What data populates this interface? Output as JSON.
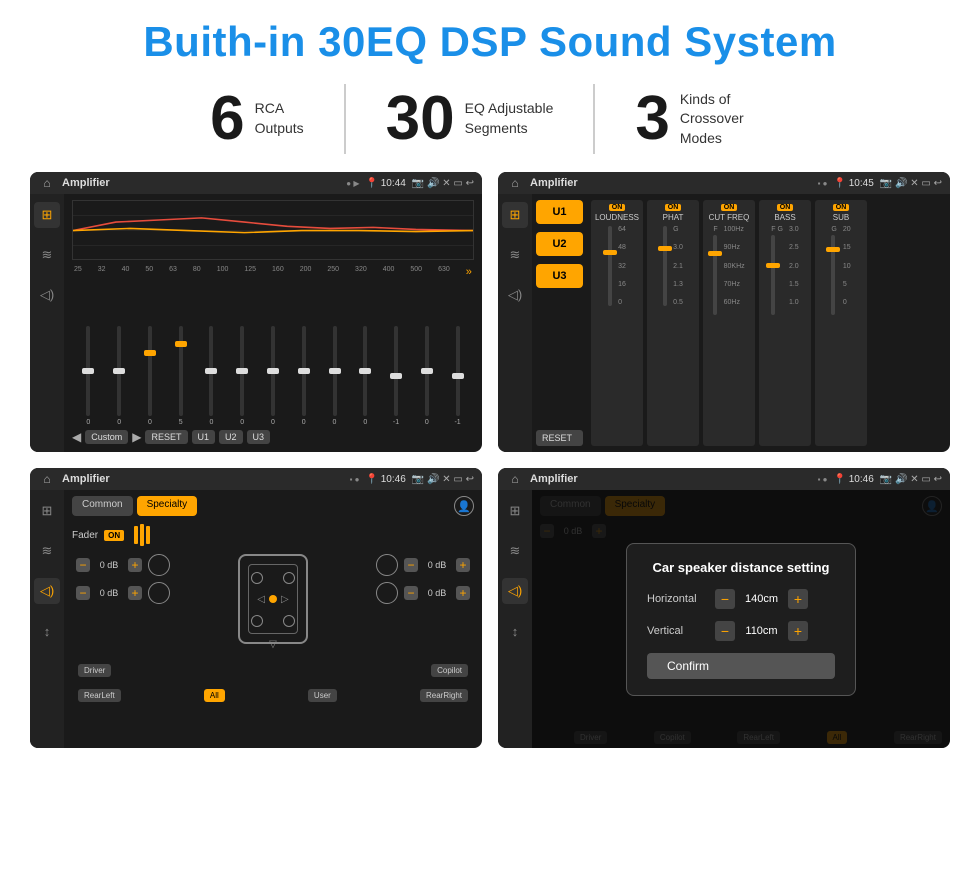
{
  "header": {
    "title": "Buith-in 30EQ DSP Sound System"
  },
  "stats": [
    {
      "number": "6",
      "desc": "RCA\nOutputs"
    },
    {
      "number": "30",
      "desc": "EQ Adjustable\nSegments"
    },
    {
      "number": "3",
      "desc": "Kinds of\nCrossover Modes"
    }
  ],
  "screens": [
    {
      "id": "screen1",
      "topbar": {
        "title": "Amplifier",
        "time": "10:44"
      },
      "type": "eq"
    },
    {
      "id": "screen2",
      "topbar": {
        "title": "Amplifier",
        "time": "10:45"
      },
      "type": "crossover"
    },
    {
      "id": "screen3",
      "topbar": {
        "title": "Amplifier",
        "time": "10:46"
      },
      "type": "fader"
    },
    {
      "id": "screen4",
      "topbar": {
        "title": "Amplifier",
        "time": "10:46"
      },
      "type": "distance"
    }
  ],
  "eq": {
    "frequencies": [
      "25",
      "32",
      "40",
      "50",
      "63",
      "80",
      "100",
      "125",
      "160",
      "200",
      "250",
      "320",
      "400",
      "500",
      "630"
    ],
    "values": [
      "0",
      "0",
      "0",
      "5",
      "0",
      "0",
      "0",
      "0",
      "0",
      "0",
      "-1",
      "0",
      "-1"
    ],
    "preset": "Custom",
    "buttons": [
      "RESET",
      "U1",
      "U2",
      "U3"
    ]
  },
  "crossover": {
    "units": [
      "U1",
      "U2",
      "U3"
    ],
    "cols": [
      {
        "label": "LOUDNESS",
        "on": true
      },
      {
        "label": "PHAT",
        "on": true
      },
      {
        "label": "CUT FREQ",
        "on": true
      },
      {
        "label": "BASS",
        "on": true
      },
      {
        "label": "SUB",
        "on": true
      }
    ]
  },
  "fader": {
    "tabs": [
      "Common",
      "Specialty"
    ],
    "fader_label": "Fader",
    "on_label": "ON",
    "volumes": [
      "0 dB",
      "0 dB",
      "0 dB",
      "0 dB"
    ],
    "bottom_labels": [
      "Driver",
      "",
      "Copilot",
      "RearLeft",
      "All",
      "User",
      "RearRight"
    ]
  },
  "distance": {
    "tabs": [
      "Common",
      "Specialty"
    ],
    "dialog": {
      "title": "Car speaker distance setting",
      "horizontal_label": "Horizontal",
      "horizontal_value": "140cm",
      "vertical_label": "Vertical",
      "vertical_value": "110cm",
      "confirm_label": "Confirm"
    }
  }
}
